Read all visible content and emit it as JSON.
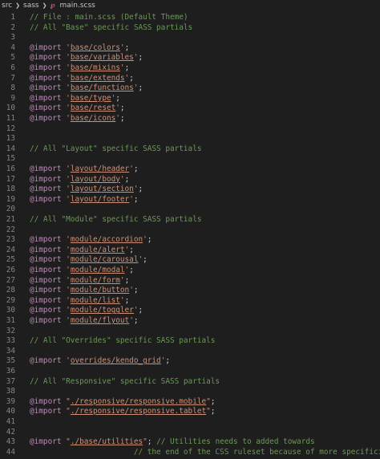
{
  "breadcrumb": {
    "items": [
      "src",
      "sass",
      "main.scss"
    ]
  },
  "editor": {
    "lines": [
      {
        "n": "1",
        "parts": [
          [
            "comment",
            "// File : main.scss (Default Theme)"
          ]
        ]
      },
      {
        "n": "2",
        "parts": [
          [
            "comment",
            "// All \"Base\" specific SASS partials"
          ]
        ]
      },
      {
        "n": "3",
        "parts": []
      },
      {
        "n": "4",
        "parts": [
          [
            "kw",
            "@import "
          ],
          [
            "str",
            "'"
          ],
          [
            "path",
            "base/colors"
          ],
          [
            "str",
            "'"
          ],
          [
            "punc",
            ";"
          ]
        ]
      },
      {
        "n": "5",
        "parts": [
          [
            "kw",
            "@import "
          ],
          [
            "str",
            "'"
          ],
          [
            "path",
            "base/variables"
          ],
          [
            "str",
            "'"
          ],
          [
            "punc",
            ";"
          ]
        ]
      },
      {
        "n": "6",
        "parts": [
          [
            "kw",
            "@import "
          ],
          [
            "str",
            "'"
          ],
          [
            "path",
            "base/mixins"
          ],
          [
            "str",
            "'"
          ],
          [
            "punc",
            ";"
          ]
        ]
      },
      {
        "n": "7",
        "parts": [
          [
            "kw",
            "@import "
          ],
          [
            "str",
            "'"
          ],
          [
            "path",
            "base/extends"
          ],
          [
            "str",
            "'"
          ],
          [
            "punc",
            ";"
          ]
        ]
      },
      {
        "n": "8",
        "parts": [
          [
            "kw",
            "@import "
          ],
          [
            "str",
            "'"
          ],
          [
            "path",
            "base/functions"
          ],
          [
            "str",
            "'"
          ],
          [
            "punc",
            ";"
          ]
        ]
      },
      {
        "n": "9",
        "parts": [
          [
            "kw",
            "@import "
          ],
          [
            "str",
            "'"
          ],
          [
            "path",
            "base/type"
          ],
          [
            "str",
            "'"
          ],
          [
            "punc",
            ";"
          ]
        ]
      },
      {
        "n": "10",
        "parts": [
          [
            "kw",
            "@import "
          ],
          [
            "str",
            "'"
          ],
          [
            "path",
            "base/reset"
          ],
          [
            "str",
            "'"
          ],
          [
            "punc",
            ";"
          ]
        ]
      },
      {
        "n": "11",
        "parts": [
          [
            "kw",
            "@import "
          ],
          [
            "str",
            "'"
          ],
          [
            "path",
            "base/icons"
          ],
          [
            "str",
            "'"
          ],
          [
            "punc",
            ";"
          ]
        ]
      },
      {
        "n": "12",
        "parts": []
      },
      {
        "n": "13",
        "parts": []
      },
      {
        "n": "14",
        "parts": [
          [
            "comment",
            "// All \"Layout\" specific SASS partials"
          ]
        ]
      },
      {
        "n": "15",
        "parts": []
      },
      {
        "n": "16",
        "parts": [
          [
            "kw",
            "@import "
          ],
          [
            "str",
            "'"
          ],
          [
            "path",
            "layout/header"
          ],
          [
            "str",
            "'"
          ],
          [
            "punc",
            ";"
          ]
        ]
      },
      {
        "n": "17",
        "parts": [
          [
            "kw",
            "@import "
          ],
          [
            "str",
            "'"
          ],
          [
            "path",
            "layout/body"
          ],
          [
            "str",
            "'"
          ],
          [
            "punc",
            ";"
          ]
        ]
      },
      {
        "n": "18",
        "parts": [
          [
            "kw",
            "@import "
          ],
          [
            "str",
            "'"
          ],
          [
            "path",
            "layout/section"
          ],
          [
            "str",
            "'"
          ],
          [
            "punc",
            ";"
          ]
        ]
      },
      {
        "n": "19",
        "parts": [
          [
            "kw",
            "@import "
          ],
          [
            "str",
            "'"
          ],
          [
            "path",
            "layout/footer"
          ],
          [
            "str",
            "'"
          ],
          [
            "punc",
            ";"
          ]
        ]
      },
      {
        "n": "20",
        "parts": []
      },
      {
        "n": "21",
        "parts": [
          [
            "comment",
            "// All \"Module\" specific SASS partials"
          ]
        ]
      },
      {
        "n": "22",
        "parts": []
      },
      {
        "n": "23",
        "parts": [
          [
            "kw",
            "@import "
          ],
          [
            "str",
            "'"
          ],
          [
            "path",
            "module/accordion"
          ],
          [
            "str",
            "'"
          ],
          [
            "punc",
            ";"
          ]
        ]
      },
      {
        "n": "24",
        "parts": [
          [
            "kw",
            "@import "
          ],
          [
            "str",
            "'"
          ],
          [
            "path",
            "module/alert"
          ],
          [
            "str",
            "'"
          ],
          [
            "punc",
            ";"
          ]
        ]
      },
      {
        "n": "25",
        "parts": [
          [
            "kw",
            "@import "
          ],
          [
            "str",
            "'"
          ],
          [
            "path",
            "module/carousal"
          ],
          [
            "str",
            "'"
          ],
          [
            "punc",
            ";"
          ]
        ]
      },
      {
        "n": "26",
        "parts": [
          [
            "kw",
            "@import "
          ],
          [
            "str",
            "'"
          ],
          [
            "path",
            "module/modal"
          ],
          [
            "str",
            "'"
          ],
          [
            "punc",
            ";"
          ]
        ]
      },
      {
        "n": "27",
        "parts": [
          [
            "kw",
            "@import "
          ],
          [
            "str",
            "'"
          ],
          [
            "path",
            "module/form"
          ],
          [
            "str",
            "'"
          ],
          [
            "punc",
            ";"
          ]
        ]
      },
      {
        "n": "28",
        "parts": [
          [
            "kw",
            "@import "
          ],
          [
            "str",
            "'"
          ],
          [
            "path",
            "module/button"
          ],
          [
            "str",
            "'"
          ],
          [
            "punc",
            ";"
          ]
        ]
      },
      {
        "n": "29",
        "parts": [
          [
            "kw",
            "@import "
          ],
          [
            "str",
            "'"
          ],
          [
            "path",
            "module/list"
          ],
          [
            "str",
            "'"
          ],
          [
            "punc",
            ";"
          ]
        ]
      },
      {
        "n": "30",
        "parts": [
          [
            "kw",
            "@import "
          ],
          [
            "str",
            "'"
          ],
          [
            "path",
            "module/toggler"
          ],
          [
            "str",
            "'"
          ],
          [
            "punc",
            ";"
          ]
        ]
      },
      {
        "n": "31",
        "parts": [
          [
            "kw",
            "@import "
          ],
          [
            "str",
            "'"
          ],
          [
            "path",
            "module/flyout"
          ],
          [
            "str",
            "'"
          ],
          [
            "punc",
            ";"
          ]
        ]
      },
      {
        "n": "32",
        "parts": []
      },
      {
        "n": "33",
        "parts": [
          [
            "comment",
            "// All \"Overrides\" specific SASS partials"
          ]
        ]
      },
      {
        "n": "34",
        "parts": []
      },
      {
        "n": "35",
        "parts": [
          [
            "kw",
            "@import "
          ],
          [
            "str",
            "'"
          ],
          [
            "path",
            "overrides/kendo_grid"
          ],
          [
            "str",
            "'"
          ],
          [
            "punc",
            ";"
          ]
        ]
      },
      {
        "n": "36",
        "parts": []
      },
      {
        "n": "37",
        "parts": [
          [
            "comment",
            "// All \"Responsive\" specific SASS partials"
          ]
        ]
      },
      {
        "n": "38",
        "parts": []
      },
      {
        "n": "39",
        "parts": [
          [
            "kw",
            "@import "
          ],
          [
            "str",
            "\""
          ],
          [
            "path",
            "./responsive/responsive.mobile"
          ],
          [
            "str",
            "\""
          ],
          [
            "punc",
            ";"
          ]
        ]
      },
      {
        "n": "40",
        "parts": [
          [
            "kw",
            "@import "
          ],
          [
            "str",
            "\""
          ],
          [
            "path",
            "./responsive/responsive.tablet"
          ],
          [
            "str",
            "\""
          ],
          [
            "punc",
            ";"
          ]
        ]
      },
      {
        "n": "41",
        "parts": []
      },
      {
        "n": "42",
        "parts": []
      },
      {
        "n": "43",
        "parts": [
          [
            "kw",
            "@import "
          ],
          [
            "str",
            "\""
          ],
          [
            "path",
            "./base/utilities"
          ],
          [
            "str",
            "\""
          ],
          [
            "punc",
            "; "
          ],
          [
            "comment",
            "// Utilities needs to added towards"
          ]
        ]
      },
      {
        "n": "44",
        "parts": [
          [
            "comment",
            "                       // the end of the CSS ruleset because of more specificity"
          ]
        ]
      }
    ]
  }
}
